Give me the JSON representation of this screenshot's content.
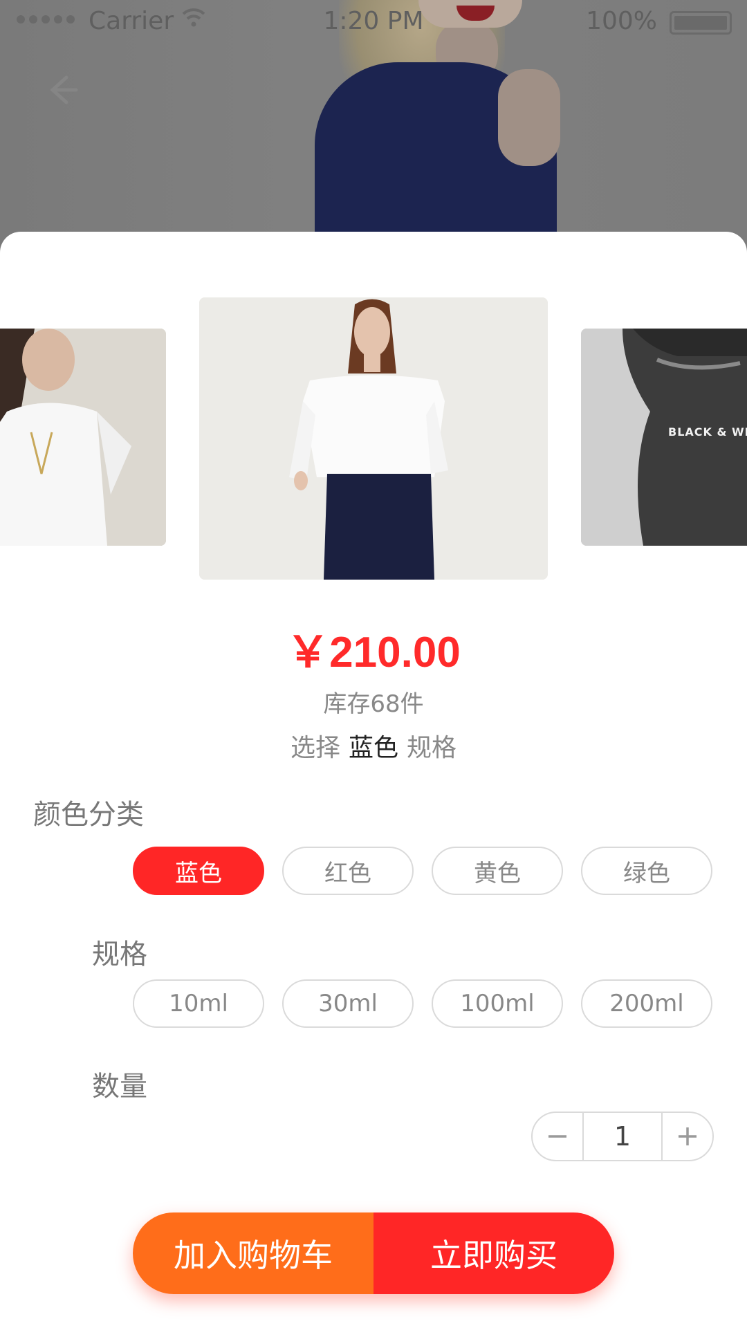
{
  "status_bar": {
    "carrier": "Carrier",
    "time": "1:20 PM",
    "battery": "100%"
  },
  "product": {
    "price": "￥210.00",
    "stock": "库存68件",
    "selection_prefix": "选择",
    "selection_value": "蓝色",
    "selection_suffix": "规格"
  },
  "carousel": {
    "right_slide_text": "BLACK & WHIT"
  },
  "color_section": {
    "title": "颜色分类",
    "options": [
      "蓝色",
      "红色",
      "黄色",
      "绿色"
    ],
    "selected": "蓝色"
  },
  "spec_section": {
    "title": "规格",
    "options": [
      "10ml",
      "30ml",
      "100ml",
      "200ml"
    ]
  },
  "quantity_section": {
    "title": "数量",
    "value": "1"
  },
  "actions": {
    "add_to_cart": "加入购物车",
    "buy_now": "立即购买"
  },
  "colors": {
    "accent_red": "#ff2626",
    "accent_orange": "#ff6d1a"
  },
  "icons": [
    "back-arrow-icon",
    "wifi-icon",
    "minus-icon",
    "plus-icon",
    "battery-icon"
  ]
}
